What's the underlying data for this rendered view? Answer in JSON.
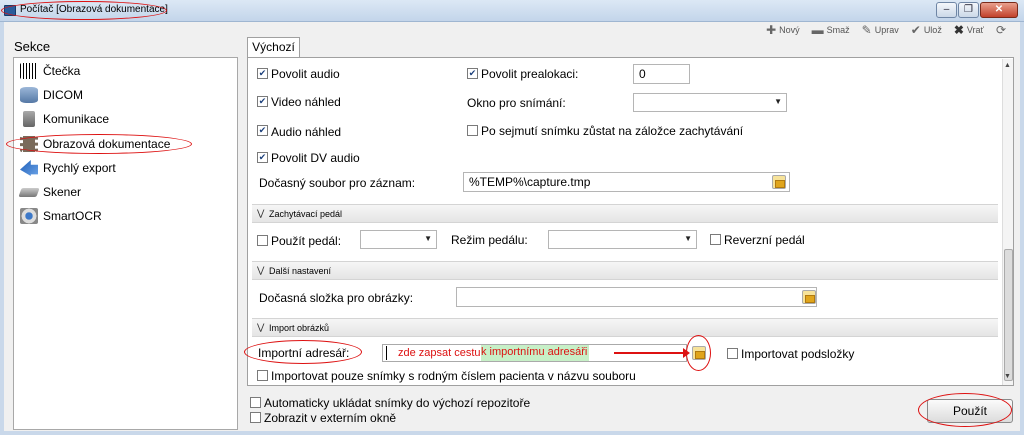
{
  "window": {
    "title": "Počítač [Obrazová dokumentace]"
  },
  "toolbar": {
    "new": "Nový",
    "delete": "Smaž",
    "edit": "Uprav",
    "save": "Ulož",
    "revert": "Vrať"
  },
  "sidebar": {
    "label": "Sekce",
    "items": [
      {
        "label": "Čtečka",
        "icon": "barcode-icon"
      },
      {
        "label": "DICOM",
        "icon": "database-icon"
      },
      {
        "label": "Komunikace",
        "icon": "plug-icon"
      },
      {
        "label": "Obrazová dokumentace",
        "icon": "film-icon"
      },
      {
        "label": "Rychlý export",
        "icon": "export-arrow-icon"
      },
      {
        "label": "Skener",
        "icon": "scanner-icon"
      },
      {
        "label": "SmartOCR",
        "icon": "ocr-icon"
      }
    ],
    "selected": "Obrazová dokumentace"
  },
  "tab": {
    "label": "Výchozí"
  },
  "form": {
    "povolit_audio": "Povolit audio",
    "video_nahled": "Video náhled",
    "audio_nahled": "Audio náhled",
    "povolit_dv_audio": "Povolit DV audio",
    "povolit_prealokaci": "Povolit prealokaci:",
    "prealokace_value": "0",
    "okno_pro_snimani": "Okno pro snímání:",
    "po_sejmuti": "Po sejmutí snímku zůstat na záložce zachytávání",
    "docasny_soubor_label": "Dočasný soubor pro záznam:",
    "docasny_soubor_value": "%TEMP%\\capture.tmp"
  },
  "groups": {
    "pedal": {
      "title": "Zachytávací pedál",
      "pouzit_pedal": "Použít pedál:",
      "rezim_pedalu": "Režim pedálu:",
      "reverzni_pedal": "Reverzní pedál"
    },
    "dalsi": {
      "title": "Další nastavení",
      "docasna_slozka": "Dočasná složka pro obrázky:"
    },
    "import": {
      "title": "Import obrázků",
      "importni_adresar": "Importní adresář:",
      "hint_red": "zde zapsat cestu",
      "hint_green": "k importnímu adresáři",
      "importovat_podslozky": "Importovat podsložky",
      "importovat_pouze": "Importovat pouze snímky s rodným číslem pacienta v názvu souboru"
    }
  },
  "footer": {
    "auto_ukladat": "Automaticky ukládat snímky do výchozí repozitoře",
    "zobrazit_v_oknu": "Zobrazit v externím okně",
    "apply": "Použít"
  },
  "colors": {
    "annotation": "#d11111",
    "highlight": "#c7f0c7"
  }
}
